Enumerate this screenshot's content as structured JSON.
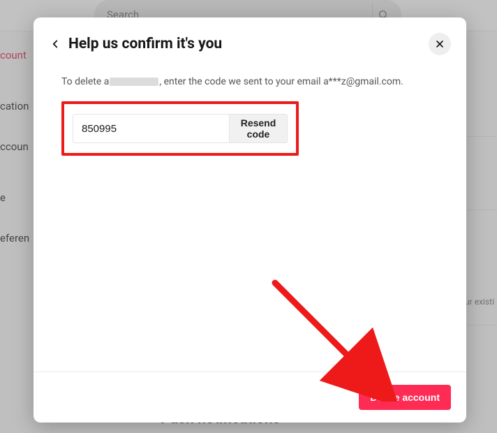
{
  "bg": {
    "search_placeholder": "Search",
    "sidebar": {
      "items": [
        "count",
        "cation",
        "ccoun",
        "e",
        "eferen"
      ]
    },
    "note_text": "ur existi",
    "push_heading": "Push notifications"
  },
  "modal": {
    "title": "Help us confirm it's you",
    "instr_prefix": "To delete a",
    "instr_mid": ", enter the code we sent to your email ",
    "masked_email": "a***z@gmail.com",
    "instr_suffix": ".",
    "code_value": "850995",
    "resend_label": "Resend code",
    "delete_label": "Delete account"
  },
  "colors": {
    "accent_red": "#fe2c55",
    "annotation_red": "#ee1a1a"
  }
}
